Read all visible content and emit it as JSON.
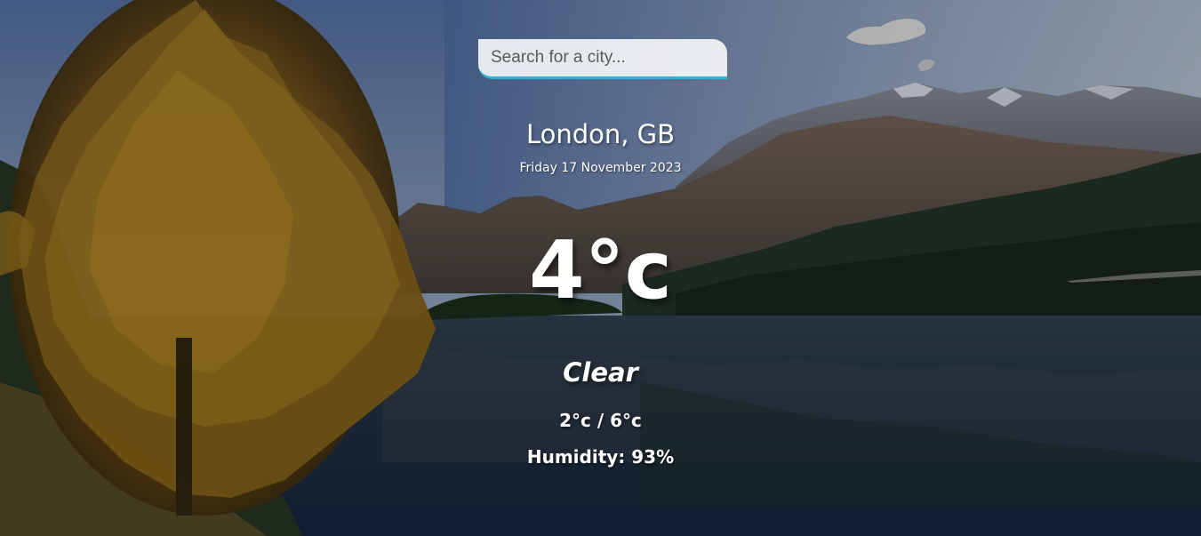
{
  "search": {
    "placeholder": "Search for a city...",
    "value": ""
  },
  "location": {
    "city_country": "London, GB",
    "date": "Friday 17 November 2023"
  },
  "current": {
    "temperature": "4°c",
    "condition": "Clear",
    "hi_lo": "2°c / 6°c",
    "humidity": "Humidity: 93%"
  },
  "theme": {
    "search_accent": "#2fb3dc",
    "text_color": "#ffffff"
  }
}
